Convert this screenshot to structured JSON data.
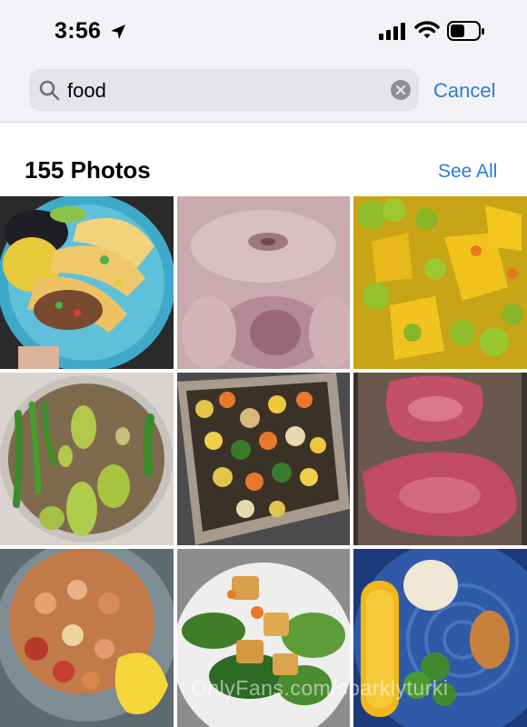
{
  "status_bar": {
    "time": "3:56"
  },
  "search": {
    "query": "food"
  },
  "cancel_label": "Cancel",
  "results": {
    "title": "155 Photos",
    "see_all_label": "See All"
  },
  "photos": [
    {
      "subject": "tacos"
    },
    {
      "subject": "skin close-up"
    },
    {
      "subject": "potatoes and broccoli soup"
    },
    {
      "subject": "peppers on soil"
    },
    {
      "subject": "roasted vegetables"
    },
    {
      "subject": "raw steaks"
    },
    {
      "subject": "pasta with shrimp"
    },
    {
      "subject": "salad with croutons"
    },
    {
      "subject": "corn, broccoli and mashed potatoes"
    }
  ],
  "watermark": "OnlyFans.com/sparklyturki"
}
